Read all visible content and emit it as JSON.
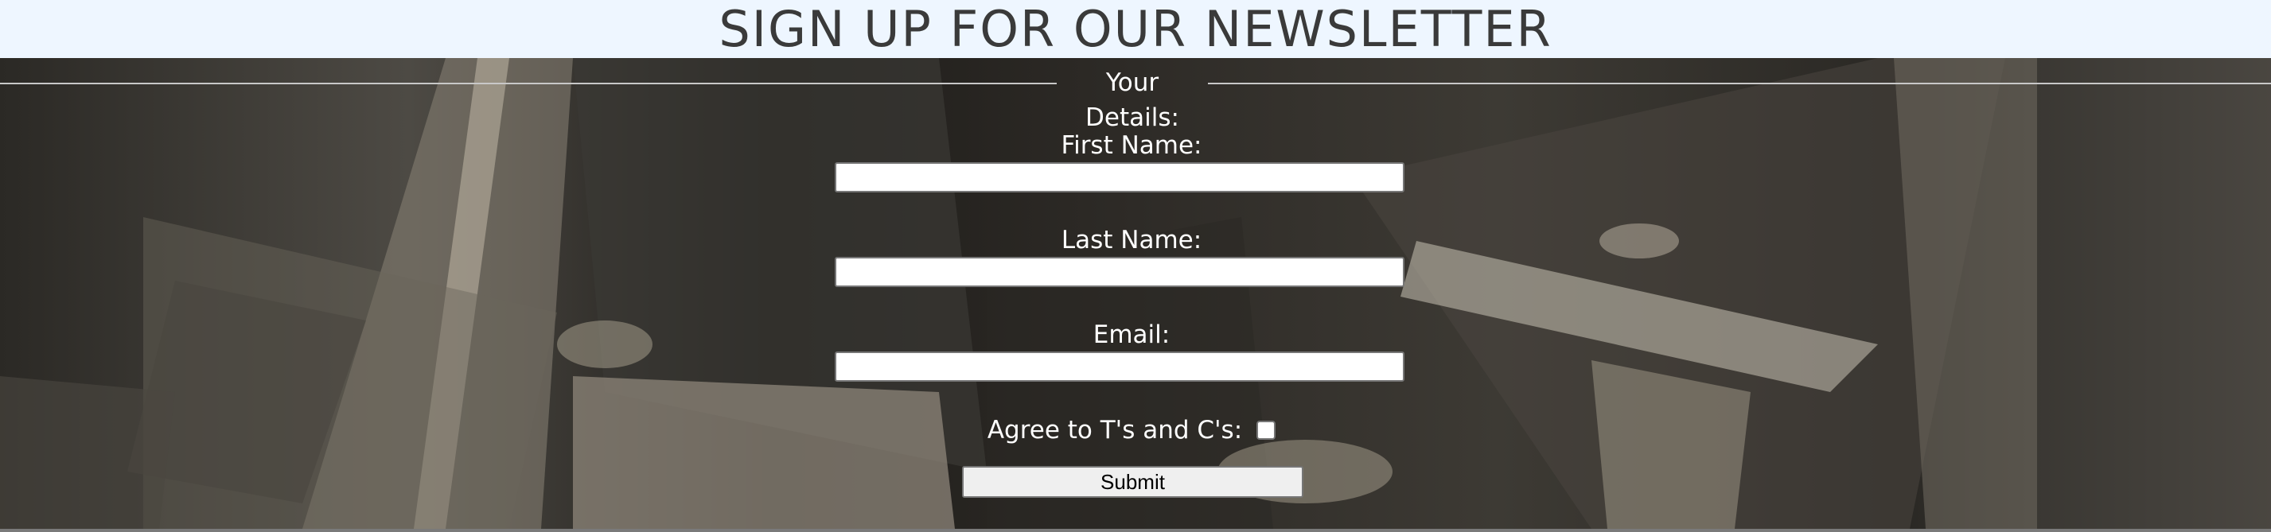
{
  "header": {
    "title": "SIGN UP FOR OUR NEWSLETTER"
  },
  "form": {
    "legend": "Your Details:",
    "first_name": {
      "label": "First Name:",
      "value": ""
    },
    "last_name": {
      "label": "Last Name:",
      "value": ""
    },
    "email": {
      "label": "Email:",
      "value": ""
    },
    "agree": {
      "label": "Agree to T's and C's:",
      "checked": false
    },
    "submit_label": "Submit"
  },
  "colors": {
    "header_bg": "#eef6ff",
    "title_text": "#3a3a3a",
    "form_text": "#ffffff",
    "button_bg": "#efefef"
  }
}
